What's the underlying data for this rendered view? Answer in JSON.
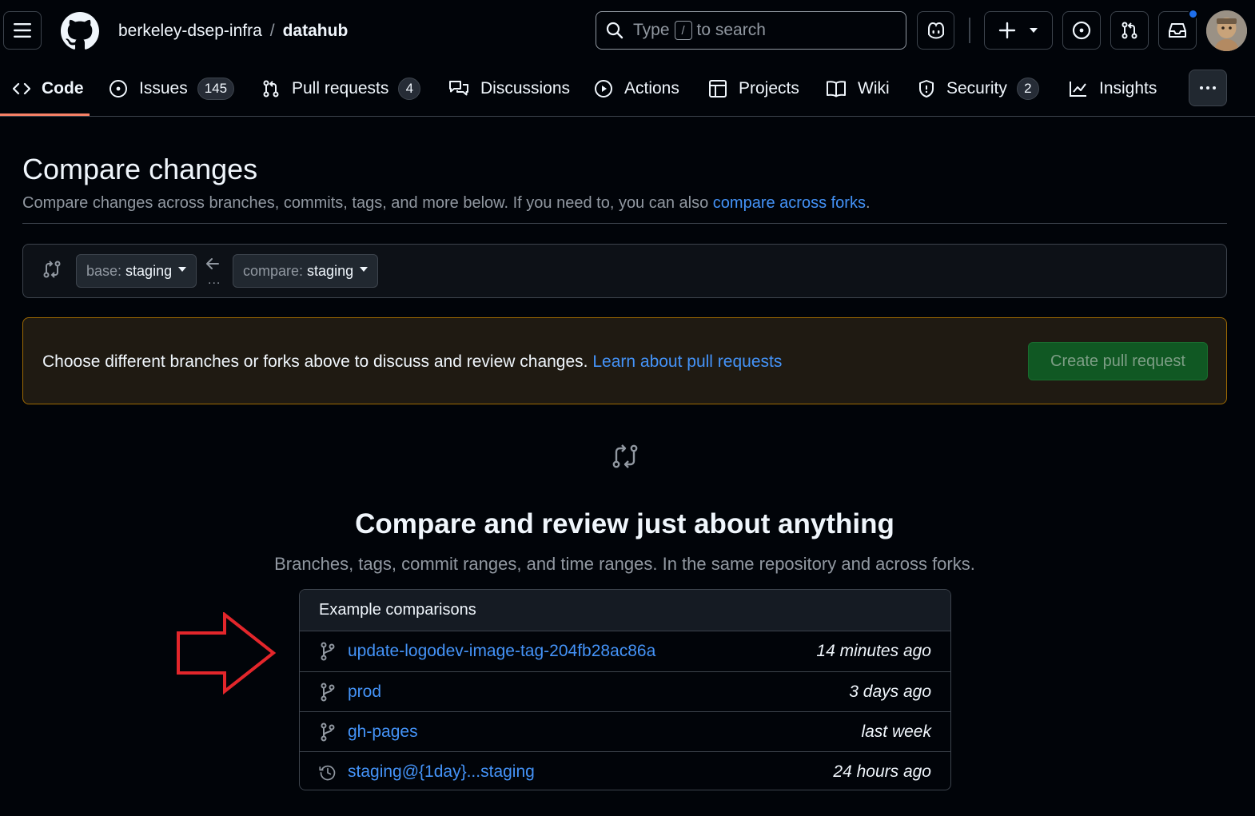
{
  "header": {
    "owner": "berkeley-dsep-infra",
    "separator": "/",
    "repo": "datahub",
    "search_prefix": "Type",
    "search_key": "/",
    "search_suffix": "to search"
  },
  "repo_nav": {
    "items": [
      {
        "label": "Code",
        "icon": "code-icon",
        "active": true
      },
      {
        "label": "Issues",
        "icon": "issue-opened-icon",
        "count": "145"
      },
      {
        "label": "Pull requests",
        "icon": "git-pull-request-icon",
        "count": "4"
      },
      {
        "label": "Discussions",
        "icon": "comment-discussion-icon"
      },
      {
        "label": "Actions",
        "icon": "play-icon"
      },
      {
        "label": "Projects",
        "icon": "table-icon"
      },
      {
        "label": "Wiki",
        "icon": "book-icon"
      },
      {
        "label": "Security",
        "icon": "shield-icon",
        "count": "2"
      },
      {
        "label": "Insights",
        "icon": "graph-icon"
      }
    ]
  },
  "page": {
    "title": "Compare changes",
    "description": "Compare changes across branches, commits, tags, and more below. If you need to, you can also ",
    "forks_link": "compare across forks",
    "description_end": "."
  },
  "range": {
    "base_label": "base:",
    "base_branch": "staging",
    "compare_label": "compare:",
    "compare_branch": "staging",
    "dots": "..."
  },
  "flash": {
    "message": "Choose different branches or forks above to discuss and review changes. ",
    "link": "Learn about pull requests",
    "create_button": "Create pull request"
  },
  "blankslate": {
    "title": "Compare and review just about anything",
    "description": "Branches, tags, commit ranges, and time ranges. In the same repository and across forks."
  },
  "examples": {
    "heading": "Example comparisons",
    "rows": [
      {
        "icon": "git-branch-icon",
        "name": "update-logodev-image-tag-204fb28ac86a",
        "time": "14 minutes ago"
      },
      {
        "icon": "git-branch-icon",
        "name": "prod",
        "time": "3 days ago"
      },
      {
        "icon": "git-branch-icon",
        "name": "gh-pages",
        "time": "last week"
      },
      {
        "icon": "history-icon",
        "name": "staging@{1day}...staging",
        "time": "24 hours ago"
      }
    ]
  },
  "colors": {
    "background": "#010409",
    "link": "#4493f8",
    "border": "#3d444d",
    "flash_border": "#9e6a03",
    "create_button": "#105823",
    "annotation_arrow": "#e3262b"
  }
}
